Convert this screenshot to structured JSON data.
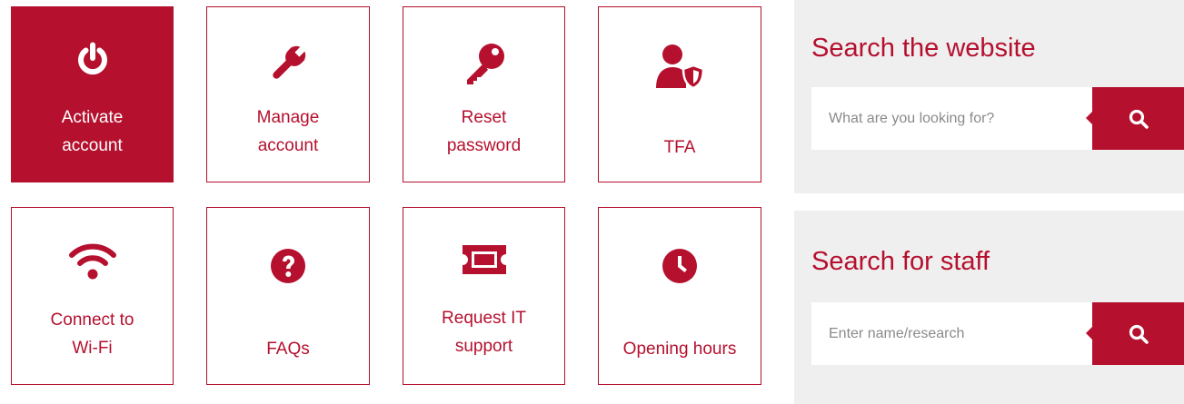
{
  "theme": {
    "accent": "#b5102e",
    "panel_bg": "#efefef",
    "text_on_accent": "#ffffff"
  },
  "tiles": [
    {
      "icon": "power-icon",
      "label_lines": [
        "Activate",
        "account"
      ],
      "active": true
    },
    {
      "icon": "wrench-icon",
      "label_lines": [
        "Manage",
        "account"
      ],
      "active": false
    },
    {
      "icon": "key-icon",
      "label_lines": [
        "Reset",
        "password"
      ],
      "active": false
    },
    {
      "icon": "user-shield-icon",
      "label_lines": [
        "TFA"
      ],
      "active": false
    },
    {
      "icon": "wifi-icon",
      "label_lines": [
        "Connect to",
        "Wi-Fi"
      ],
      "active": false
    },
    {
      "icon": "question-circle-icon",
      "label_lines": [
        "FAQs"
      ],
      "active": false
    },
    {
      "icon": "ticket-icon",
      "label_lines": [
        "Request IT",
        "support"
      ],
      "active": false
    },
    {
      "icon": "clock-icon",
      "label_lines": [
        "Opening hours"
      ],
      "active": false
    }
  ],
  "search_website": {
    "title": "Search the website",
    "placeholder": "What are you looking for?",
    "value": "",
    "button_icon": "search-icon"
  },
  "search_staff": {
    "title": "Search for staff",
    "placeholder": "Enter name/research",
    "value": "",
    "button_icon": "search-icon"
  }
}
